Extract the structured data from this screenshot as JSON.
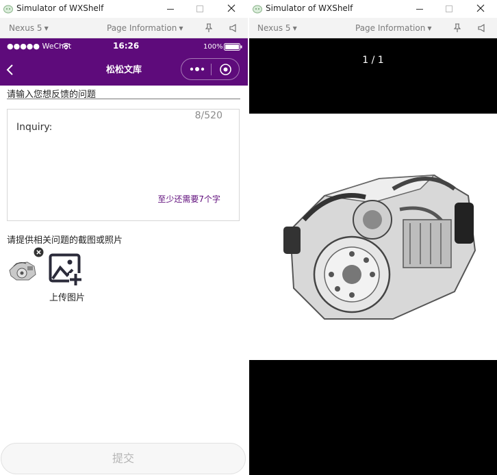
{
  "left_window": {
    "title": "Simulator of WXShelf",
    "toolbar": {
      "device": "Nexus 5",
      "page_info": "Page Information"
    },
    "status_bar": {
      "carrier": "●●●●● WeChat",
      "time": "16:26",
      "battery": "100%"
    },
    "nav": {
      "title": "松松文库"
    },
    "form": {
      "question_label": "请输入您想反馈的问题",
      "textarea_value": "Inquiry:",
      "counter": "8/520",
      "min_hint": "至少还需要7个字",
      "photo_label": "请提供相关问题的截图或照片",
      "upload_label": "上传图片",
      "submit_label": "提交"
    }
  },
  "right_window": {
    "title": "Simulator of WXShelf",
    "toolbar": {
      "device": "Nexus 5",
      "page_info": "Page Information"
    },
    "viewer": {
      "counter": "1 / 1"
    }
  },
  "colors": {
    "brand": "#5e0b7b",
    "hint": "#5e0b7b",
    "viewer_bg": "#000000"
  },
  "icons": [
    "app-icon",
    "minimize-icon",
    "maximize-icon",
    "close-icon",
    "pin-icon",
    "speaker-icon",
    "back-arrow-icon",
    "more-dots-icon",
    "exit-circle-icon",
    "remove-icon",
    "add-image-icon",
    "wifi-icon",
    "battery-icon"
  ]
}
